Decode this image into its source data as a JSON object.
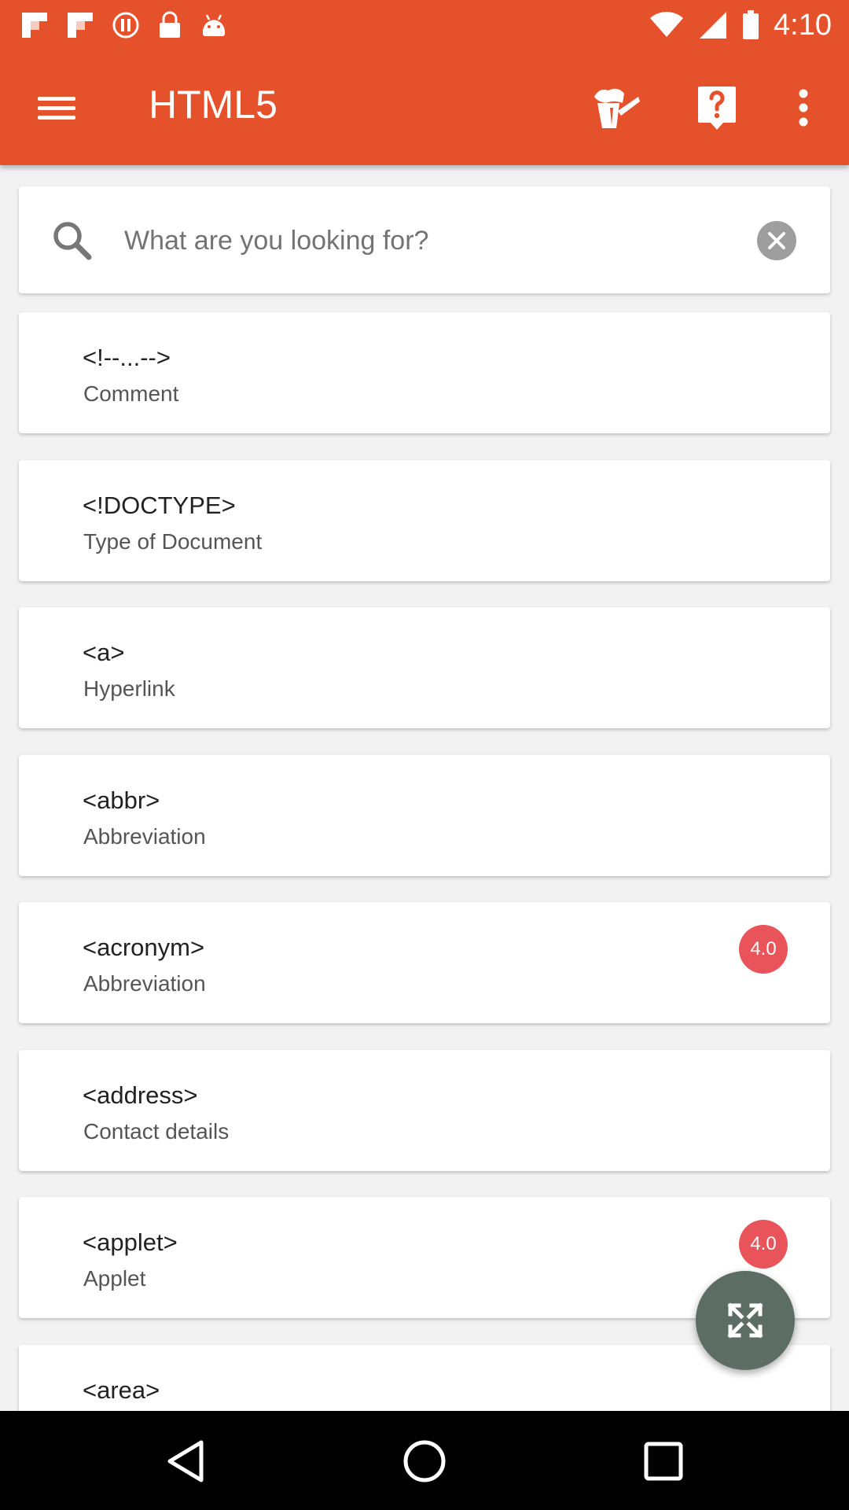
{
  "status_bar": {
    "time": "4:10",
    "left_icons": [
      "flipboard-icon",
      "flipboard-icon",
      "app-icon",
      "lock-icon",
      "android-icon"
    ],
    "right_icons": [
      "wifi-icon",
      "signal-icon",
      "battery-icon"
    ]
  },
  "app_bar": {
    "title": "HTML5",
    "actions": [
      "shop-icon",
      "help-icon",
      "more-icon"
    ],
    "color": "#e4512a"
  },
  "search": {
    "placeholder": "What are you looking for?",
    "value": ""
  },
  "items": [
    {
      "tag": "<!--...-->",
      "desc": "Comment",
      "badge": ""
    },
    {
      "tag": "<!DOCTYPE>",
      "desc": "Type of Document",
      "badge": ""
    },
    {
      "tag": "<a>",
      "desc": "Hyperlink",
      "badge": ""
    },
    {
      "tag": "<abbr>",
      "desc": "Abbreviation",
      "badge": ""
    },
    {
      "tag": "<acronym>",
      "desc": "Abbreviation",
      "badge": "4.0"
    },
    {
      "tag": "<address>",
      "desc": "Contact details",
      "badge": ""
    },
    {
      "tag": "<applet>",
      "desc": "Applet",
      "badge": "4.0"
    },
    {
      "tag": "<area>",
      "desc": "",
      "badge": ""
    }
  ],
  "fab": {
    "icon": "expand-icon"
  },
  "nav_bar": {
    "buttons": [
      "back-icon",
      "home-icon",
      "recents-icon"
    ]
  },
  "colors": {
    "badge": "#e9545a",
    "fab": "#5c6d64"
  }
}
